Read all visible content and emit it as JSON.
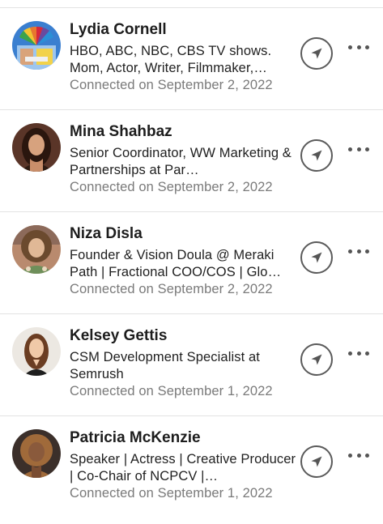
{
  "connections": [
    {
      "name": "Lydia Cornell",
      "headline": "HBO, ABC, NBC, CBS TV shows. Mom, Actor, Writer, Filmmaker,…",
      "connected": "Connected on September 2, 2022",
      "avatar_icon": "tv-network-collage-avatar"
    },
    {
      "name": "Mina Shahbaz",
      "headline": "Senior Coordinator, WW Marketing & Partnerships at Par…",
      "connected": "Connected on September 2, 2022",
      "avatar_icon": "woman-dark-hair-avatar"
    },
    {
      "name": "Niza Disla",
      "headline": "Founder & Vision Doula @ Meraki Path | Fractional COO/COS | Glo…",
      "connected": "Connected on September 2, 2022",
      "avatar_icon": "woman-curly-hair-avatar"
    },
    {
      "name": "Kelsey Gettis",
      "headline": "CSM Development Specialist at Semrush",
      "connected": "Connected on September 1, 2022",
      "avatar_icon": "woman-long-brown-hair-avatar"
    },
    {
      "name": "Patricia McKenzie",
      "headline": "Speaker | Actress | Creative Producer | Co-Chair of NCPCV |…",
      "connected": "Connected on September 1, 2022",
      "avatar_icon": "woman-curly-highlights-avatar"
    }
  ],
  "actions": {
    "send_icon": "paper-plane-icon",
    "more_icon": "more-horizontal-icon"
  },
  "colors": {
    "name_text": "#1d1d1d",
    "secondary_text": "#7a7a7a",
    "divider": "#e3e3e3",
    "icon": "#5a5a5a"
  }
}
